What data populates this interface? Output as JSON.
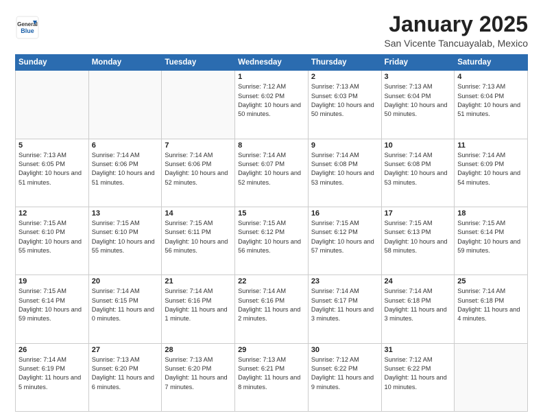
{
  "header": {
    "logo_general": "General",
    "logo_blue": "Blue",
    "month_title": "January 2025",
    "location": "San Vicente Tancuayalab, Mexico"
  },
  "weekdays": [
    "Sunday",
    "Monday",
    "Tuesday",
    "Wednesday",
    "Thursday",
    "Friday",
    "Saturday"
  ],
  "weeks": [
    [
      {
        "day": "",
        "info": ""
      },
      {
        "day": "",
        "info": ""
      },
      {
        "day": "",
        "info": ""
      },
      {
        "day": "1",
        "info": "Sunrise: 7:12 AM\nSunset: 6:02 PM\nDaylight: 10 hours\nand 50 minutes."
      },
      {
        "day": "2",
        "info": "Sunrise: 7:13 AM\nSunset: 6:03 PM\nDaylight: 10 hours\nand 50 minutes."
      },
      {
        "day": "3",
        "info": "Sunrise: 7:13 AM\nSunset: 6:04 PM\nDaylight: 10 hours\nand 50 minutes."
      },
      {
        "day": "4",
        "info": "Sunrise: 7:13 AM\nSunset: 6:04 PM\nDaylight: 10 hours\nand 51 minutes."
      }
    ],
    [
      {
        "day": "5",
        "info": "Sunrise: 7:13 AM\nSunset: 6:05 PM\nDaylight: 10 hours\nand 51 minutes."
      },
      {
        "day": "6",
        "info": "Sunrise: 7:14 AM\nSunset: 6:06 PM\nDaylight: 10 hours\nand 51 minutes."
      },
      {
        "day": "7",
        "info": "Sunrise: 7:14 AM\nSunset: 6:06 PM\nDaylight: 10 hours\nand 52 minutes."
      },
      {
        "day": "8",
        "info": "Sunrise: 7:14 AM\nSunset: 6:07 PM\nDaylight: 10 hours\nand 52 minutes."
      },
      {
        "day": "9",
        "info": "Sunrise: 7:14 AM\nSunset: 6:08 PM\nDaylight: 10 hours\nand 53 minutes."
      },
      {
        "day": "10",
        "info": "Sunrise: 7:14 AM\nSunset: 6:08 PM\nDaylight: 10 hours\nand 53 minutes."
      },
      {
        "day": "11",
        "info": "Sunrise: 7:14 AM\nSunset: 6:09 PM\nDaylight: 10 hours\nand 54 minutes."
      }
    ],
    [
      {
        "day": "12",
        "info": "Sunrise: 7:15 AM\nSunset: 6:10 PM\nDaylight: 10 hours\nand 55 minutes."
      },
      {
        "day": "13",
        "info": "Sunrise: 7:15 AM\nSunset: 6:10 PM\nDaylight: 10 hours\nand 55 minutes."
      },
      {
        "day": "14",
        "info": "Sunrise: 7:15 AM\nSunset: 6:11 PM\nDaylight: 10 hours\nand 56 minutes."
      },
      {
        "day": "15",
        "info": "Sunrise: 7:15 AM\nSunset: 6:12 PM\nDaylight: 10 hours\nand 56 minutes."
      },
      {
        "day": "16",
        "info": "Sunrise: 7:15 AM\nSunset: 6:12 PM\nDaylight: 10 hours\nand 57 minutes."
      },
      {
        "day": "17",
        "info": "Sunrise: 7:15 AM\nSunset: 6:13 PM\nDaylight: 10 hours\nand 58 minutes."
      },
      {
        "day": "18",
        "info": "Sunrise: 7:15 AM\nSunset: 6:14 PM\nDaylight: 10 hours\nand 59 minutes."
      }
    ],
    [
      {
        "day": "19",
        "info": "Sunrise: 7:15 AM\nSunset: 6:14 PM\nDaylight: 10 hours\nand 59 minutes."
      },
      {
        "day": "20",
        "info": "Sunrise: 7:14 AM\nSunset: 6:15 PM\nDaylight: 11 hours\nand 0 minutes."
      },
      {
        "day": "21",
        "info": "Sunrise: 7:14 AM\nSunset: 6:16 PM\nDaylight: 11 hours\nand 1 minute."
      },
      {
        "day": "22",
        "info": "Sunrise: 7:14 AM\nSunset: 6:16 PM\nDaylight: 11 hours\nand 2 minutes."
      },
      {
        "day": "23",
        "info": "Sunrise: 7:14 AM\nSunset: 6:17 PM\nDaylight: 11 hours\nand 3 minutes."
      },
      {
        "day": "24",
        "info": "Sunrise: 7:14 AM\nSunset: 6:18 PM\nDaylight: 11 hours\nand 3 minutes."
      },
      {
        "day": "25",
        "info": "Sunrise: 7:14 AM\nSunset: 6:18 PM\nDaylight: 11 hours\nand 4 minutes."
      }
    ],
    [
      {
        "day": "26",
        "info": "Sunrise: 7:14 AM\nSunset: 6:19 PM\nDaylight: 11 hours\nand 5 minutes."
      },
      {
        "day": "27",
        "info": "Sunrise: 7:13 AM\nSunset: 6:20 PM\nDaylight: 11 hours\nand 6 minutes."
      },
      {
        "day": "28",
        "info": "Sunrise: 7:13 AM\nSunset: 6:20 PM\nDaylight: 11 hours\nand 7 minutes."
      },
      {
        "day": "29",
        "info": "Sunrise: 7:13 AM\nSunset: 6:21 PM\nDaylight: 11 hours\nand 8 minutes."
      },
      {
        "day": "30",
        "info": "Sunrise: 7:12 AM\nSunset: 6:22 PM\nDaylight: 11 hours\nand 9 minutes."
      },
      {
        "day": "31",
        "info": "Sunrise: 7:12 AM\nSunset: 6:22 PM\nDaylight: 11 hours\nand 10 minutes."
      },
      {
        "day": "",
        "info": ""
      }
    ]
  ]
}
